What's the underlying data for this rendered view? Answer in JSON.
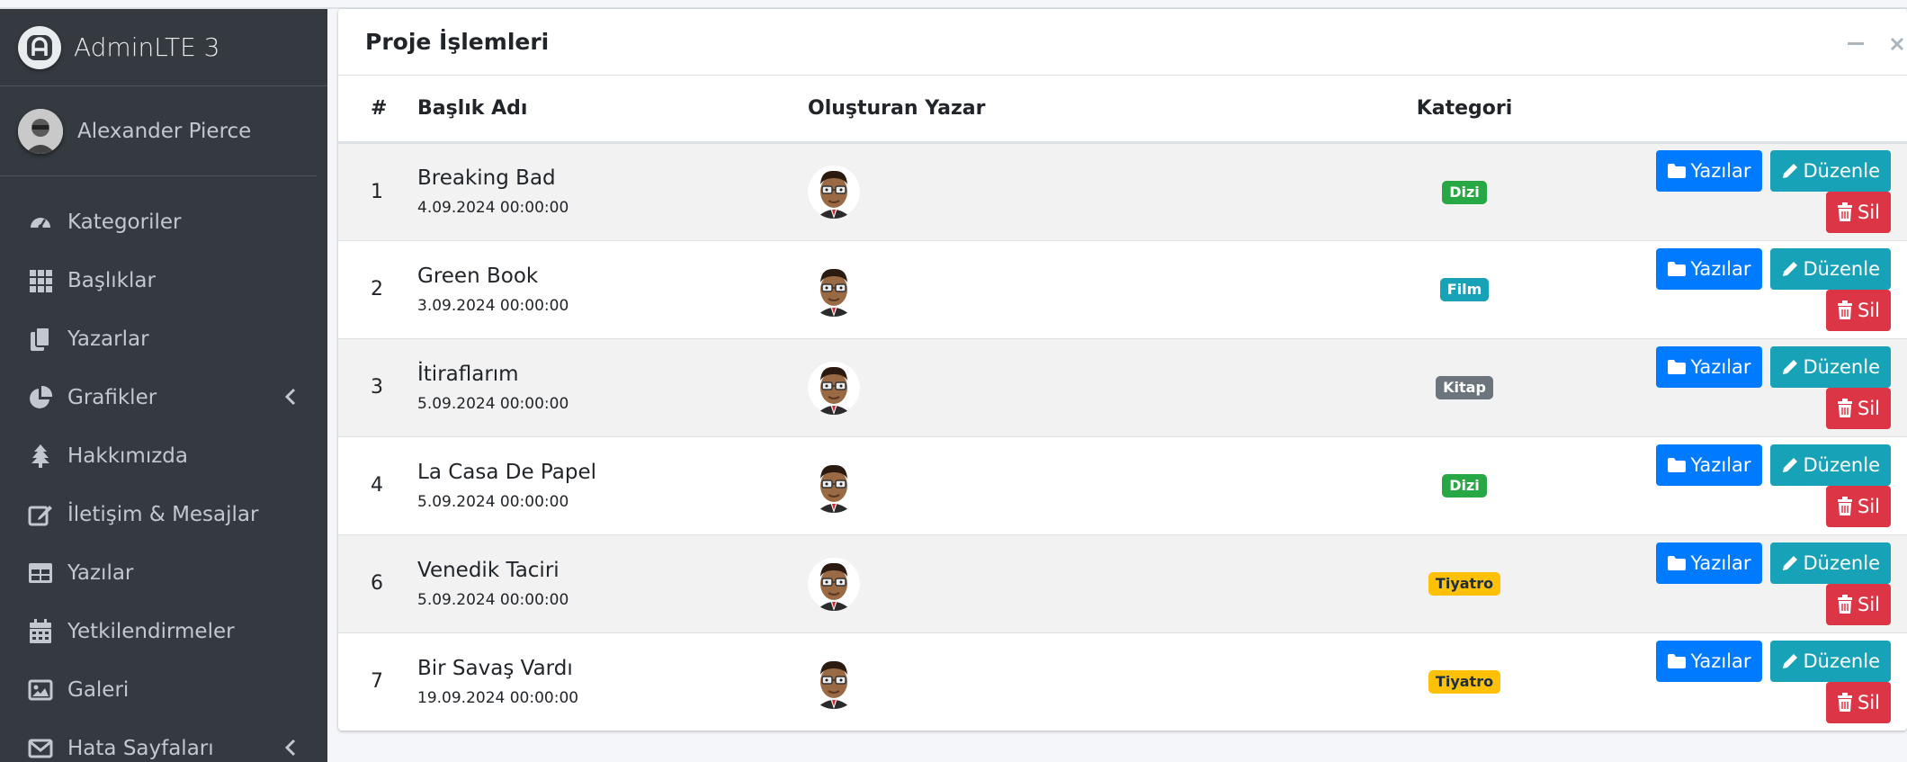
{
  "brand": {
    "name": "AdminLTE 3"
  },
  "user": {
    "name": "Alexander Pierce"
  },
  "sidebar": {
    "items": [
      {
        "label": "Kategoriler",
        "icon": "tachometer-icon"
      },
      {
        "label": "Başlıklar",
        "icon": "grid-icon"
      },
      {
        "label": "Yazarlar",
        "icon": "copy-icon"
      },
      {
        "label": "Grafikler",
        "icon": "pie-chart-icon",
        "has_arrow": true
      },
      {
        "label": "Hakkımızda",
        "icon": "tree-icon"
      },
      {
        "label": "İletişim & Mesajlar",
        "icon": "edit-icon"
      },
      {
        "label": "Yazılar",
        "icon": "table-icon"
      },
      {
        "label": "Yetkilendirmeler",
        "icon": "calendar-icon"
      },
      {
        "label": "Galeri",
        "icon": "image-icon"
      },
      {
        "label": "Hata Sayfaları",
        "icon": "envelope-icon",
        "has_arrow": true
      }
    ]
  },
  "card": {
    "title": "Proje İşlemleri",
    "columns": [
      "#",
      "Başlık Adı",
      "Oluşturan Yazar",
      "Kategori"
    ],
    "buttons": {
      "posts": "Yazılar",
      "edit": "Düzenle",
      "delete": "Sil"
    },
    "rows": [
      {
        "num": "1",
        "title": "Breaking Bad",
        "date": "4.09.2024 00:00:00",
        "category": "Dizi",
        "cat_color": "#28a745",
        "cat_text": "#ffffff"
      },
      {
        "num": "2",
        "title": "Green Book",
        "date": "3.09.2024 00:00:00",
        "category": "Film",
        "cat_color": "#17a2b8",
        "cat_text": "#ffffff"
      },
      {
        "num": "3",
        "title": "İtiraflarım",
        "date": "5.09.2024 00:00:00",
        "category": "Kitap",
        "cat_color": "#6c757d",
        "cat_text": "#ffffff"
      },
      {
        "num": "4",
        "title": "La Casa De Papel",
        "date": "5.09.2024 00:00:00",
        "category": "Dizi",
        "cat_color": "#28a745",
        "cat_text": "#ffffff"
      },
      {
        "num": "6",
        "title": "Venedik Taciri",
        "date": "5.09.2024 00:00:00",
        "category": "Tiyatro",
        "cat_color": "#ffc107",
        "cat_text": "#1f2d3d"
      },
      {
        "num": "7",
        "title": "Bir Savaş Vardı",
        "date": "19.09.2024 00:00:00",
        "category": "Tiyatro",
        "cat_color": "#ffc107",
        "cat_text": "#1f2d3d"
      }
    ]
  }
}
